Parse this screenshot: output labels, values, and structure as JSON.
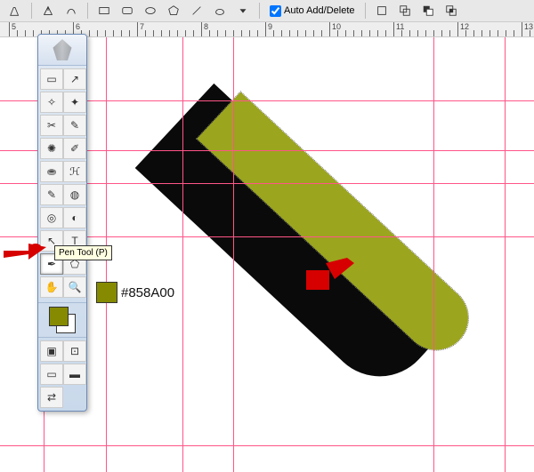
{
  "topbar": {
    "auto_add_delete": "Auto Add/Delete"
  },
  "ruler": {
    "ticks": [
      "5",
      "6",
      "7",
      "8",
      "9",
      "10",
      "11",
      "12",
      "13"
    ]
  },
  "guides": {
    "v_positions": [
      49,
      119,
      205,
      262,
      487,
      567
    ],
    "h_positions": [
      72,
      128,
      165,
      225,
      460
    ]
  },
  "toolbox": {
    "tools": [
      {
        "glyph": "▭",
        "name": "rect-marquee"
      },
      {
        "glyph": "↗",
        "name": "move"
      },
      {
        "glyph": "✧",
        "name": "lasso"
      },
      {
        "glyph": "✦",
        "name": "wand"
      },
      {
        "glyph": "✂",
        "name": "crop"
      },
      {
        "glyph": "✎",
        "name": "slice"
      },
      {
        "glyph": "✺",
        "name": "healing"
      },
      {
        "glyph": "✐",
        "name": "brush"
      },
      {
        "glyph": "⛂",
        "name": "stamp"
      },
      {
        "glyph": "ℋ",
        "name": "history"
      },
      {
        "glyph": "✎",
        "name": "eraser"
      },
      {
        "glyph": "◍",
        "name": "gradient"
      },
      {
        "glyph": "◎",
        "name": "blur"
      },
      {
        "glyph": "◐",
        "name": "dodge"
      },
      {
        "glyph": "↖",
        "name": "path-select"
      },
      {
        "glyph": "T",
        "name": "type"
      },
      {
        "glyph": "✒",
        "name": "pen",
        "selected": true
      },
      {
        "glyph": "⬠",
        "name": "shape"
      },
      {
        "glyph": "✋",
        "name": "hand-tool"
      },
      {
        "glyph": "🔍",
        "name": "zoom"
      }
    ],
    "bottom": [
      {
        "glyph": "▣",
        "name": "quick-mask"
      },
      {
        "glyph": "⊡",
        "name": "screen-standard"
      },
      {
        "glyph": "▭",
        "name": "screen-full-menu"
      },
      {
        "glyph": "▬",
        "name": "screen-full"
      },
      {
        "glyph": "⇄",
        "name": "image-ready"
      }
    ]
  },
  "tooltip": {
    "pen": "Pen Tool (P)"
  },
  "color": {
    "hex": "#858A00"
  }
}
